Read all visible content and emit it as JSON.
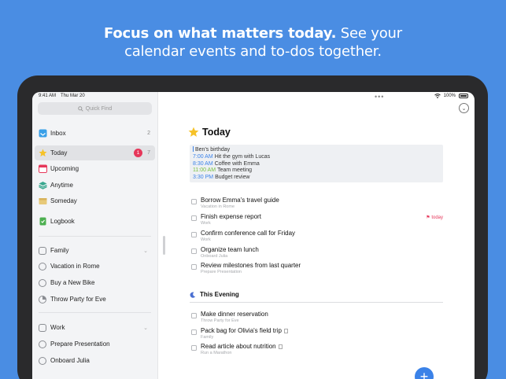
{
  "headline": {
    "bold": "Focus on what matters today.",
    "rest_line1": " See your",
    "line2": "calendar events and to-dos together."
  },
  "status": {
    "time": "9:41 AM",
    "date": "Thu Mar 20",
    "battery": "100%"
  },
  "sidebar": {
    "quick_find": "Quick Find",
    "lists": [
      {
        "label": "Inbox",
        "count": "2",
        "icon": "inbox-icon",
        "color": "#3aa0e8"
      },
      {
        "label": "Today",
        "count": "7",
        "badge": "1",
        "icon": "star-icon",
        "color": "#f6c228"
      },
      {
        "label": "Upcoming",
        "icon": "calendar-icon",
        "color": "#e6375a"
      },
      {
        "label": "Anytime",
        "icon": "layers-icon",
        "color": "#3aa88f"
      },
      {
        "label": "Someday",
        "icon": "archive-box-icon",
        "color": "#d8b25a"
      },
      {
        "label": "Logbook",
        "icon": "logbook-icon",
        "color": "#4caf50"
      }
    ],
    "areas": [
      {
        "label": "Family",
        "projects": [
          "Vacation in Rome",
          "Buy a New Bike",
          "Throw Party for Eve"
        ]
      },
      {
        "label": "Work",
        "projects": [
          "Prepare Presentation",
          "Onboard Julia"
        ]
      }
    ]
  },
  "main": {
    "title": "Today",
    "calendar": [
      {
        "time": "",
        "title": "Ben's birthday",
        "color": "#3b82e8"
      },
      {
        "time": "7:00 AM",
        "title": "Hit the gym with Lucas",
        "color": "#3b82e8"
      },
      {
        "time": "8:30 AM",
        "title": "Coffee with Emma",
        "color": "#3b82e8"
      },
      {
        "time": "11:00 AM",
        "title": "Team meeting",
        "color": "#7ac143"
      },
      {
        "time": "3:30 PM",
        "title": "Budget review",
        "color": "#3b82e8"
      }
    ],
    "todos": [
      {
        "title": "Borrow Emma's travel guide",
        "sub": "Vacation in Rome"
      },
      {
        "title": "Finish expense report",
        "sub": "Work",
        "deadline": "today"
      },
      {
        "title": "Confirm conference call for Friday",
        "sub": "Work"
      },
      {
        "title": "Organize team lunch",
        "sub": "Onboard Julia"
      },
      {
        "title": "Review milestones from last quarter",
        "sub": "Prepare Presentation"
      }
    ],
    "evening_label": "This Evening",
    "evening_todos": [
      {
        "title": "Make dinner reservation",
        "sub": "Throw Party for Eve"
      },
      {
        "title": "Pack bag for Olivia's field trip",
        "sub": "Family"
      },
      {
        "title": "Read article about nutrition",
        "sub": "Run a Marathon"
      }
    ]
  }
}
